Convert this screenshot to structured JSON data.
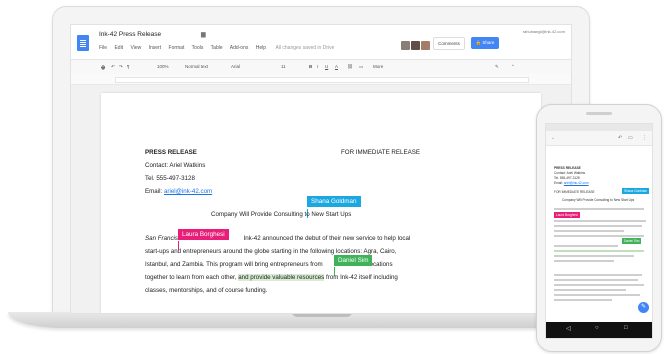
{
  "doc": {
    "title": "Ink-42 Press Release",
    "account": "rahulnangi@ink-42.com",
    "menu": [
      "File",
      "Edit",
      "View",
      "Insert",
      "Format",
      "Tools",
      "Table",
      "Add-ons",
      "Help"
    ],
    "saved_status": "All changes saved in Drive",
    "comments_label": "Comments",
    "share_label": "Share",
    "toolbar": {
      "zoom": "100%",
      "style": "Normal text",
      "font": "Arial",
      "size": "11",
      "more": "More"
    },
    "body": {
      "press_release": "PRESS RELEASE",
      "immediate": "FOR IMMEDIATE RELEASE",
      "contact": "Contact: Ariel Watkins",
      "tel": "Tel. 555-497-3128",
      "email_label": "Email:",
      "email": "ariel@ink-42.com",
      "headline": "Company Will Provide Consulting to New Start Ups",
      "p1_a": "San Francis",
      "p1_b": "Ink-42 announced the debut of their new service to help local",
      "p2_a": "start-ups and",
      "p2_b": "entrepreneurs around the globe starting in the following locations: Agra, Cairo,",
      "p3": "Istanbul, and Zambia. This program will bring entrepreneurs from",
      "p3_b": "locations",
      "p4_a": "together to learn from each other,",
      "p4_hl": "and provide valuable resources",
      "p4_b": "from Ink-42 itself including",
      "p5": "classes, mentorships, and of course funding."
    },
    "collaborators": [
      {
        "name": "Shana Goldman",
        "color": "#1ba7e0"
      },
      {
        "name": "Laura Borghesi",
        "color": "#e91e78"
      },
      {
        "name": "Daniel Sim",
        "color": "#3fb25a"
      }
    ]
  },
  "phone": {
    "press_release": "PRESS RELEASE",
    "contact": "Contact: Ariel Watkins",
    "tel": "Tel. 555-497-3128",
    "email_label": "Email:",
    "email": "ariel@ink-42.com",
    "immediate": "FOR IMMEDIATE RELEASE",
    "headline": "Company Will Provide Consulting to New Start Ups"
  }
}
